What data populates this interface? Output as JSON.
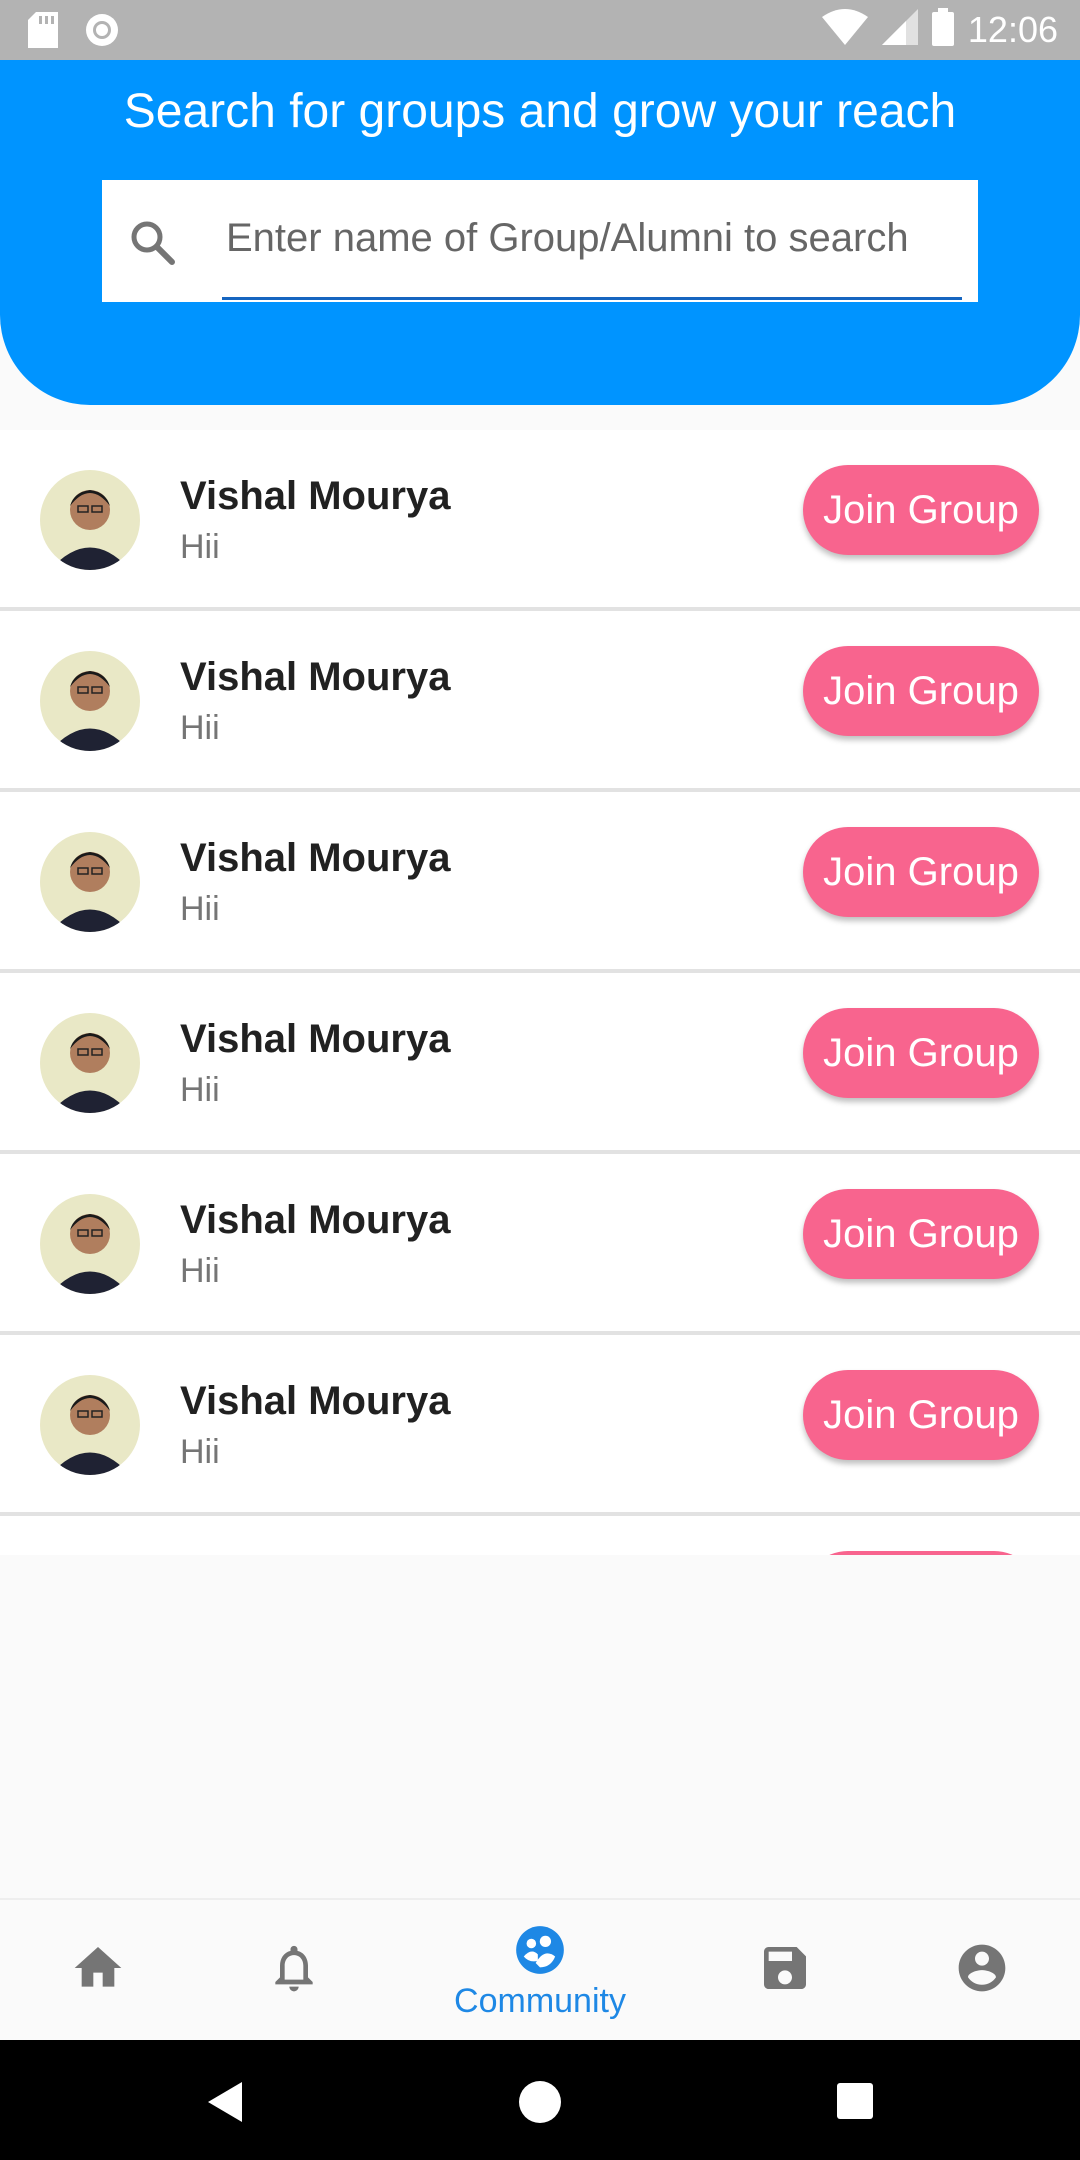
{
  "status_bar": {
    "time": "12:06"
  },
  "header": {
    "title": "Search for groups and grow your reach",
    "search_placeholder": "Enter name of Group/Alumni to search"
  },
  "groups": [
    {
      "name": "Vishal Mourya",
      "subtitle": "Hii",
      "action": "Join Group"
    },
    {
      "name": "Vishal Mourya",
      "subtitle": "Hii",
      "action": "Join Group"
    },
    {
      "name": "Vishal Mourya",
      "subtitle": "Hii",
      "action": "Join Group"
    },
    {
      "name": "Vishal Mourya",
      "subtitle": "Hii",
      "action": "Join Group"
    },
    {
      "name": "Vishal Mourya",
      "subtitle": "Hii",
      "action": "Join Group"
    },
    {
      "name": "Vishal Mourya",
      "subtitle": "Hii",
      "action": "Join Group"
    }
  ],
  "bottom_nav": {
    "items": [
      {
        "icon": "home-icon"
      },
      {
        "icon": "bell-icon"
      },
      {
        "icon": "community-icon",
        "label": "Community",
        "active": true
      },
      {
        "icon": "save-icon"
      },
      {
        "icon": "account-icon"
      }
    ],
    "active_color": "#1e88e5",
    "inactive_color": "#757575"
  },
  "colors": {
    "header": "#0094ff",
    "join_button": "#f8648e"
  }
}
